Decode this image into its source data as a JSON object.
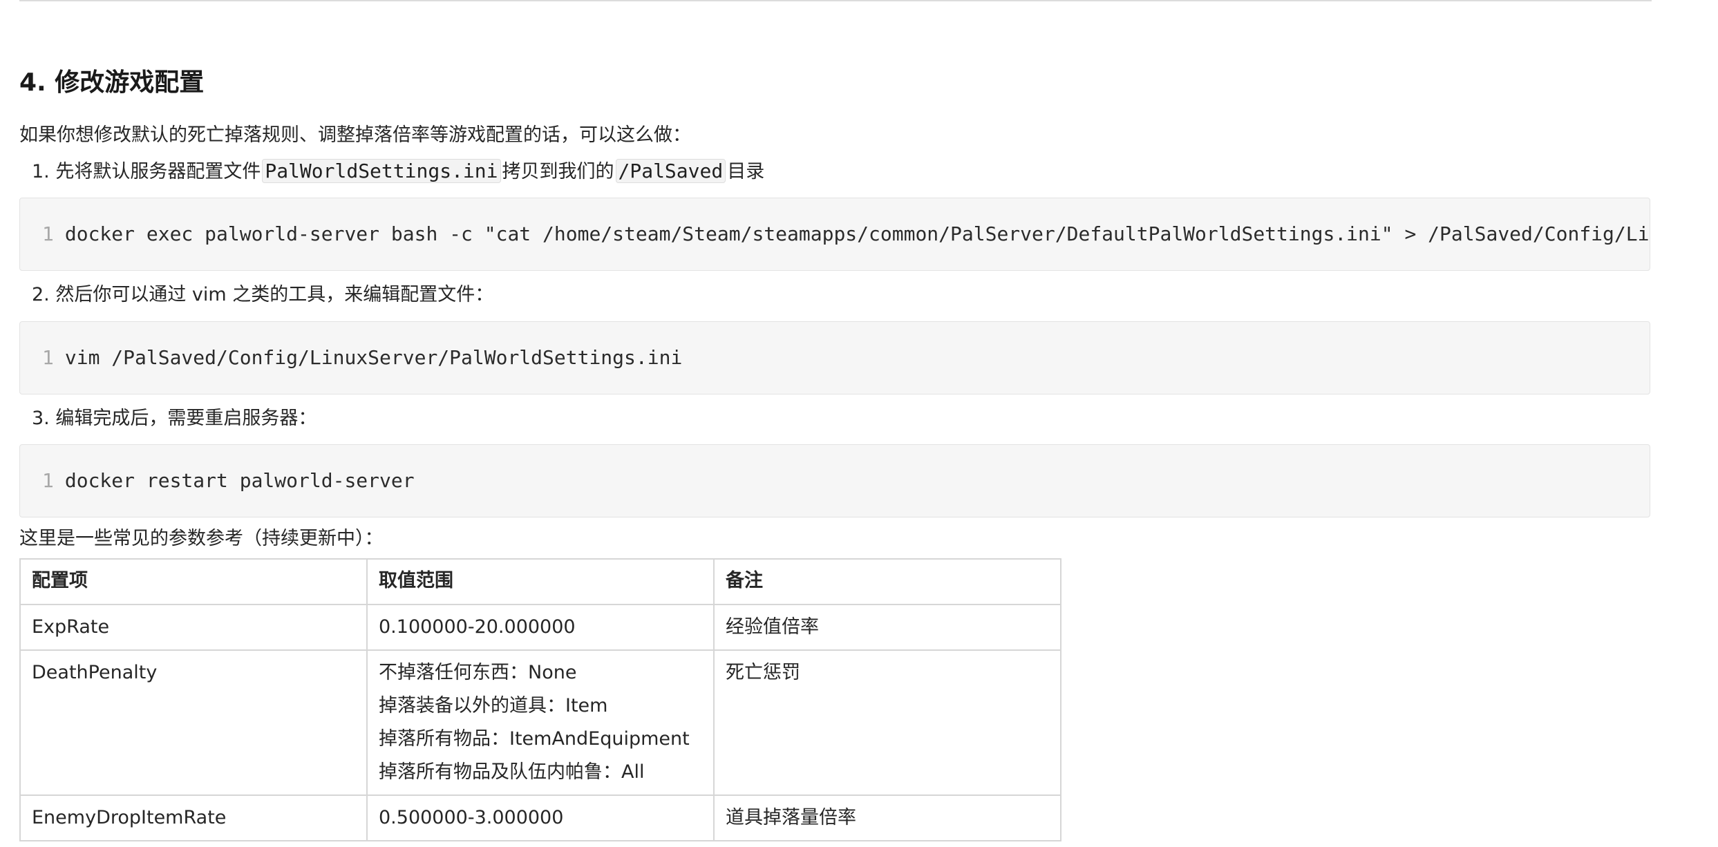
{
  "section": {
    "heading": "4. 修改游戏配置",
    "intro": "如果你想修改默认的死亡掉落规则、调整掉落倍率等游戏配置的话，可以这么做："
  },
  "steps": [
    {
      "prefix": "1. 先将默认服务器配置文件",
      "code1": "PalWorldSettings.ini",
      "middle": "拷贝到我们的",
      "code2": "/PalSaved",
      "suffix": "目录",
      "code_block": {
        "line_number": "1",
        "code": "docker exec palworld-server bash -c \"cat /home/steam/Steam/steamapps/common/PalServer/DefaultPalWorldSettings.ini\" > /PalSaved/Config/LinuxServer/PalWorldSettings.ini"
      }
    },
    {
      "text": "2. 然后你可以通过 vim 之类的工具，来编辑配置文件：",
      "code_block": {
        "line_number": "1",
        "code": "vim /PalSaved/Config/LinuxServer/PalWorldSettings.ini"
      }
    },
    {
      "text": "3. 编辑完成后，需要重启服务器：",
      "code_block": {
        "line_number": "1",
        "code": "docker restart palworld-server"
      }
    }
  ],
  "reference_intro": "这里是一些常见的参数参考（持续更新中）：",
  "table": {
    "headers": [
      "配置项",
      "取值范围",
      "备注"
    ],
    "rows": [
      {
        "key": "ExpRate",
        "range": [
          "0.100000-20.000000"
        ],
        "note": "经验值倍率"
      },
      {
        "key": "DeathPenalty",
        "range": [
          "不掉落任何东西：None",
          "掉落装备以外的道具：Item",
          "掉落所有物品：ItemAndEquipment",
          "掉落所有物品及队伍内帕鲁：All"
        ],
        "note": "死亡惩罚"
      },
      {
        "key": "EnemyDropItemRate",
        "range": [
          "0.500000-3.000000"
        ],
        "note": "道具掉落量倍率"
      }
    ]
  }
}
